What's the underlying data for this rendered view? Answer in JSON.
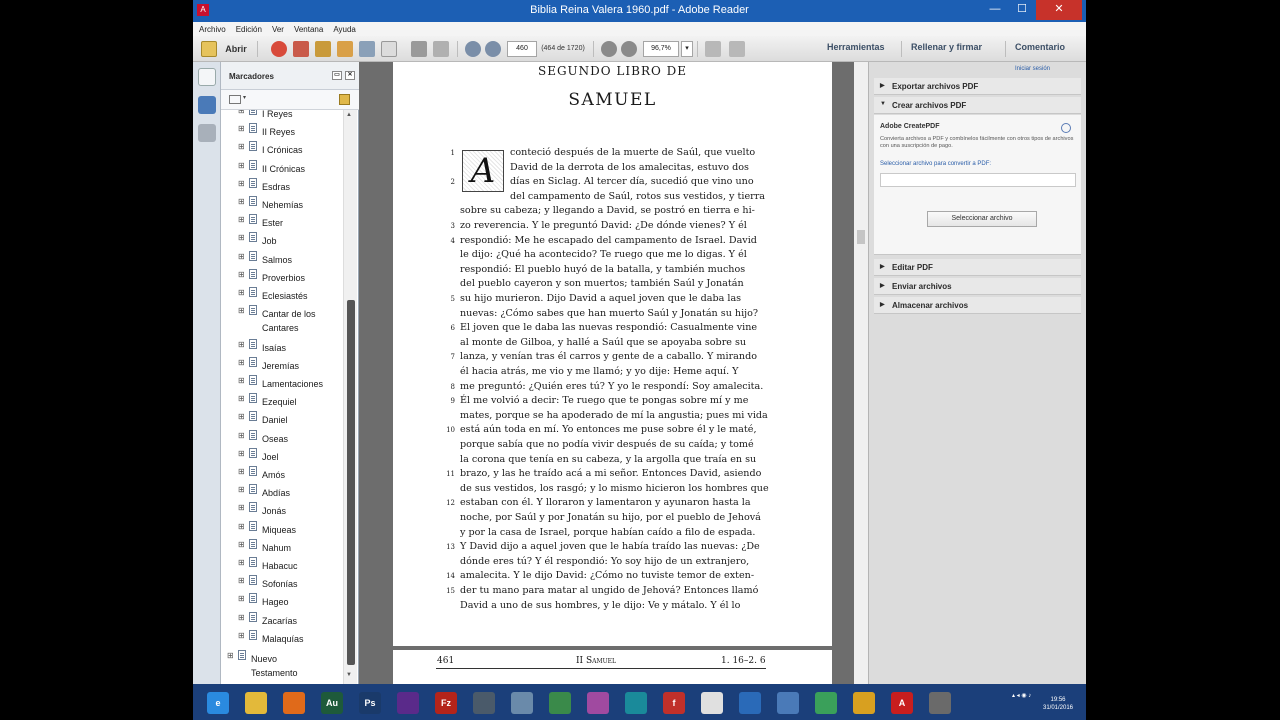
{
  "window": {
    "title": "Biblia Reina Valera 1960.pdf - Adobe Reader",
    "min": "—",
    "max": "☐",
    "close": "✕"
  },
  "menu": [
    "Archivo",
    "Edición",
    "Ver",
    "Ventana",
    "Ayuda"
  ],
  "toolbar": {
    "open_label": "Abrir",
    "page_value": "460",
    "page_count": "(464 de 1720)",
    "zoom_value": "96,7%",
    "tools_label": "Herramientas",
    "fill_sign_label": "Rellenar y firmar",
    "comment_label": "Comentario"
  },
  "bookmarks": {
    "header": "Marcadores",
    "items": [
      {
        "label": "I Reyes",
        "exp": "⊞"
      },
      {
        "label": "II Reyes",
        "exp": "⊞"
      },
      {
        "label": "I Crónicas",
        "exp": "⊞"
      },
      {
        "label": "II Crónicas",
        "exp": "⊞"
      },
      {
        "label": "Esdras",
        "exp": "⊞"
      },
      {
        "label": "Nehemías",
        "exp": "⊞"
      },
      {
        "label": "Ester",
        "exp": "⊞"
      },
      {
        "label": "Job",
        "exp": "⊞"
      },
      {
        "label": "Salmos",
        "exp": "⊞"
      },
      {
        "label": "Proverbios",
        "exp": "⊞"
      },
      {
        "label": "Eclesiastés",
        "exp": "⊞"
      },
      {
        "label": "Cantar de los",
        "label2": "Cantares",
        "exp": "⊞"
      },
      {
        "label": "Isaías",
        "exp": "⊞"
      },
      {
        "label": "Jeremías",
        "exp": "⊞"
      },
      {
        "label": "Lamentaciones",
        "exp": "⊞"
      },
      {
        "label": "Ezequiel",
        "exp": "⊞"
      },
      {
        "label": "Daniel",
        "exp": "⊞"
      },
      {
        "label": "Oseas",
        "exp": "⊞"
      },
      {
        "label": "Joel",
        "exp": "⊞"
      },
      {
        "label": "Amós",
        "exp": "⊞"
      },
      {
        "label": "Abdías",
        "exp": "⊞"
      },
      {
        "label": "Jonás",
        "exp": "⊞"
      },
      {
        "label": "Miqueas",
        "exp": "⊞"
      },
      {
        "label": "Nahum",
        "exp": "⊞"
      },
      {
        "label": "Habacuc",
        "exp": "⊞"
      },
      {
        "label": "Sofonías",
        "exp": "⊞"
      },
      {
        "label": "Hageo",
        "exp": "⊞"
      },
      {
        "label": "Zacarías",
        "exp": "⊞"
      },
      {
        "label": "Malaquías",
        "exp": "⊞"
      }
    ],
    "new_testament_1": "Nuevo",
    "new_testament_2": "Testamento"
  },
  "page": {
    "header_small": "SEGUNDO LIBRO DE",
    "header_big": "SAMUEL",
    "dropcap": "A",
    "lines": [
      {
        "n": "1",
        "t": "conteció después de la muerte de Saúl, que vuelto"
      },
      {
        "n": "",
        "t": "David de la derrota de los amalecitas, estuvo dos"
      },
      {
        "n": "2",
        "t": "días en Siclag.  Al tercer día, sucedió que vino uno"
      },
      {
        "n": "",
        "t": "del campamento de Saúl, rotos sus vestidos, y tierra"
      },
      {
        "n": "",
        "t": "sobre su cabeza; y llegando a David, se postró en tierra e hi-"
      },
      {
        "n": "3",
        "t": "zo reverencia.  Y le preguntó David: ¿De dónde vienes?  Y él"
      },
      {
        "n": "4",
        "t": "respondió: Me he escapado del campamento de Israel.  David"
      },
      {
        "n": "",
        "t": "le dijo: ¿Qué ha acontecido? Te ruego que me lo digas.  Y él"
      },
      {
        "n": "",
        "t": "respondió: El pueblo huyó de la batalla, y también muchos"
      },
      {
        "n": "",
        "t": "del pueblo cayeron y son muertos; también Saúl y Jonatán"
      },
      {
        "n": "5",
        "t": "su hijo murieron.  Dijo David a aquel joven que le daba las"
      },
      {
        "n": "",
        "t": "nuevas: ¿Cómo sabes que han muerto Saúl y Jonatán su hijo?"
      },
      {
        "n": "6",
        "t": "El joven que le daba las nuevas respondió: Casualmente vine"
      },
      {
        "n": "",
        "t": "al monte de Gilboa, y hallé a Saúl que se apoyaba sobre su"
      },
      {
        "n": "7",
        "t": "lanza, y venían tras él carros y gente de a caballo.  Y mirando"
      },
      {
        "n": "",
        "t": "él hacia atrás, me vio y me llamó; y yo dije: Heme aquí.  Y"
      },
      {
        "n": "8",
        "t": "me preguntó: ¿Quién eres tú? Y yo le respondí: Soy amalecita."
      },
      {
        "n": "9",
        "t": "Él me volvió a decir: Te ruego que te pongas sobre mí y me"
      },
      {
        "n": "",
        "t": "mates, porque se ha apoderado de mí la angustia; pues mi vida"
      },
      {
        "n": "10",
        "t": "está aún toda en mí.  Yo entonces me puse sobre él y le maté,"
      },
      {
        "n": "",
        "t": "porque sabía que no podía vivir después de su caída; y tomé"
      },
      {
        "n": "",
        "t": "la corona que tenía en su cabeza, y la argolla que traía en su"
      },
      {
        "n": "11",
        "t": "brazo, y las he traído acá a mi señor.  Entonces David, asiendo"
      },
      {
        "n": "",
        "t": "de sus vestidos, los rasgó; y lo mismo hicieron los hombres que"
      },
      {
        "n": "12",
        "t": "estaban con él.  Y lloraron y lamentaron y ayunaron hasta la"
      },
      {
        "n": "",
        "t": "noche, por Saúl y por Jonatán su hijo, por el pueblo de Jehová"
      },
      {
        "n": "",
        "t": "y por la casa de Israel, porque habían caído a filo de espada."
      },
      {
        "n": "13",
        "t": "Y David dijo a aquel joven que le había traído las nuevas: ¿De"
      },
      {
        "n": "",
        "t": "dónde eres tú? Y él respondió: Yo soy hijo de un extranjero,"
      },
      {
        "n": "14",
        "t": "amalecita.  Y le dijo David: ¿Cómo no tuviste temor de exten-"
      },
      {
        "n": "15",
        "t": "der tu mano para matar al ungido de Jehová?  Entonces llamó"
      },
      {
        "n": "",
        "t": "David a uno de sus hombres, y le dijo: Ve y mátalo.  Y él lo"
      }
    ],
    "footer_num": "461",
    "footer_book": "II Samuel",
    "footer_ref": "1. 16–2. 6"
  },
  "right_pane": {
    "signin": "Iniciar sesión",
    "export": "Exportar archivos PDF",
    "create": "Crear archivos PDF",
    "createpdf_title": "Adobe CreatePDF",
    "createpdf_desc": "Convierta archivos a PDF y combínelos fácilmente con otros tipos de archivos con una suscripción de pago.",
    "select_link": "Seleccionar archivo para convertir a PDF:",
    "select_button": "Seleccionar archivo",
    "edit": "Editar PDF",
    "send": "Enviar archivos",
    "store": "Almacenar archivos"
  },
  "taskbar": {
    "time": "19:56",
    "date": "31/01/2016"
  }
}
